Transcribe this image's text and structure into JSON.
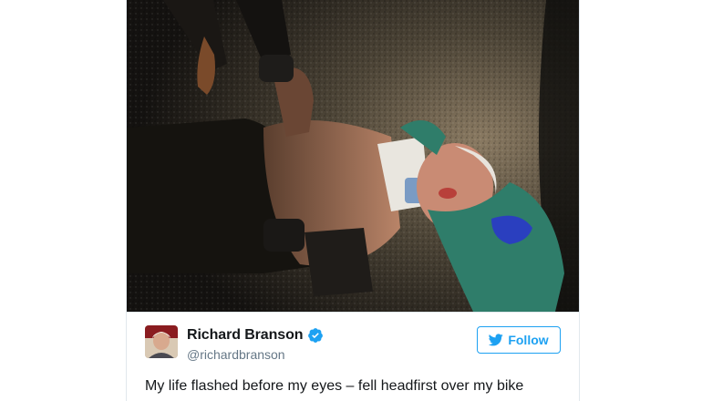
{
  "tweet": {
    "author": {
      "display_name": "Richard Branson",
      "handle": "@richardbranson",
      "verified": true,
      "verified_icon": "verified-badge-icon"
    },
    "follow_button": {
      "label": "Follow",
      "icon": "twitter-bird-icon"
    },
    "text": "My life flashed before my eyes – fell headfirst over my bike",
    "photo": {
      "icon": "photo-injured-man-neck-brace"
    }
  },
  "colors": {
    "accent": "#1da1f2",
    "text": "#14171a",
    "muted": "#657786",
    "border": "#e1e8ed"
  }
}
